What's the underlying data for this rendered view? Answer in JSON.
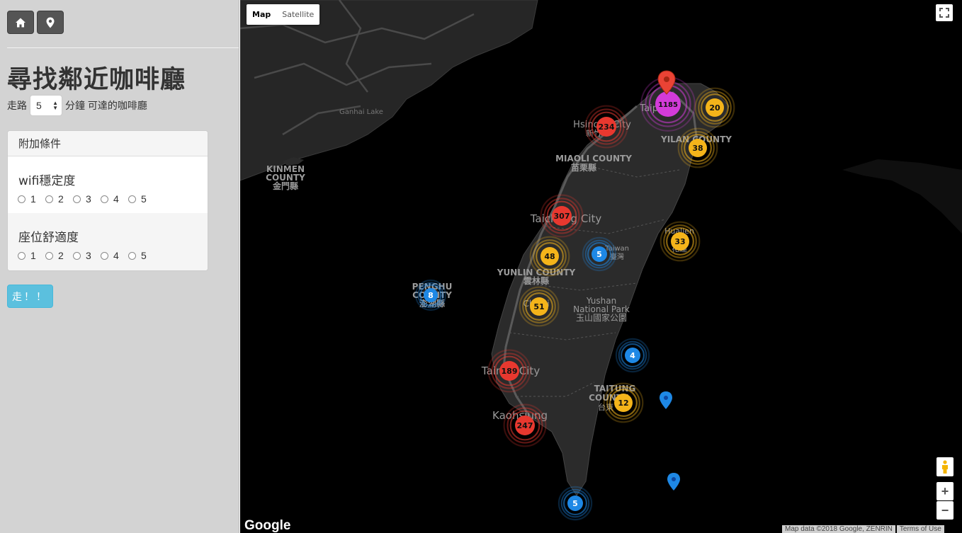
{
  "title": "尋找鄰近咖啡廳",
  "walk": {
    "prefix": "走路",
    "value": "5",
    "suffix": "分鐘 可達的咖啡廳"
  },
  "filters": {
    "heading": "附加條件",
    "groups": [
      {
        "label": "wifi穩定度",
        "options": [
          "1",
          "2",
          "3",
          "4",
          "5"
        ]
      },
      {
        "label": "座位舒適度",
        "options": [
          "1",
          "2",
          "3",
          "4",
          "5"
        ]
      }
    ]
  },
  "go_label": "走！！",
  "map": {
    "type_options": [
      "Map",
      "Satellite"
    ],
    "selected_type": "Map",
    "attribution": "Map data ©2018 Google, ZENRIN",
    "terms": "Terms of Use",
    "logo": "Google",
    "labels": {
      "kinmen": [
        "KINMEN",
        "COUNTY",
        "金門縣"
      ],
      "penghu": [
        "PENGHU",
        "COUNTY",
        "澎湖縣"
      ],
      "miaoli": [
        "MIAOLI COUNTY",
        "苗栗縣"
      ],
      "yunlin": [
        "YUNLIN COUNTY",
        "雲林縣"
      ],
      "yushan": [
        "Yushan",
        "National Park",
        "玉山國家公園"
      ],
      "taitung": [
        "TAITUNG",
        "COUNTY"
      ],
      "yilan": "YILAN COUNTY",
      "hsinchu": "Hsinchu City",
      "taichung": "Taichung City",
      "tainan": "Tainan City",
      "kaohsiung": "Kaohsiung",
      "hualien": "Hualien",
      "chiayi": "Chiayi",
      "taipei": "Taipei",
      "taiwan": "Taiwan",
      "taiwan_zh": "臺灣",
      "hsinchu_zh": "新竹",
      "hualien_zh": "花蓮",
      "taitung_zh": "台東",
      "lake": "Ganhai Lake"
    },
    "clusters": [
      {
        "count": "1185",
        "color": "magenta"
      },
      {
        "count": "20",
        "color": "yellow"
      },
      {
        "count": "234",
        "color": "red"
      },
      {
        "count": "38",
        "color": "yellow"
      },
      {
        "count": "307",
        "color": "red"
      },
      {
        "count": "33",
        "color": "yellow"
      },
      {
        "count": "48",
        "color": "yellow"
      },
      {
        "count": "5",
        "color": "blue"
      },
      {
        "count": "8",
        "color": "blue"
      },
      {
        "count": "51",
        "color": "yellow"
      },
      {
        "count": "4",
        "color": "blue"
      },
      {
        "count": "189",
        "color": "red"
      },
      {
        "count": "12",
        "color": "yellow"
      },
      {
        "count": "247",
        "color": "red"
      },
      {
        "count": "5",
        "color": "blue"
      }
    ],
    "colors": {
      "red": "#e8382f",
      "yellow": "#f4b41a",
      "blue": "#1e88e5",
      "magenta": "#d33bd9"
    }
  }
}
